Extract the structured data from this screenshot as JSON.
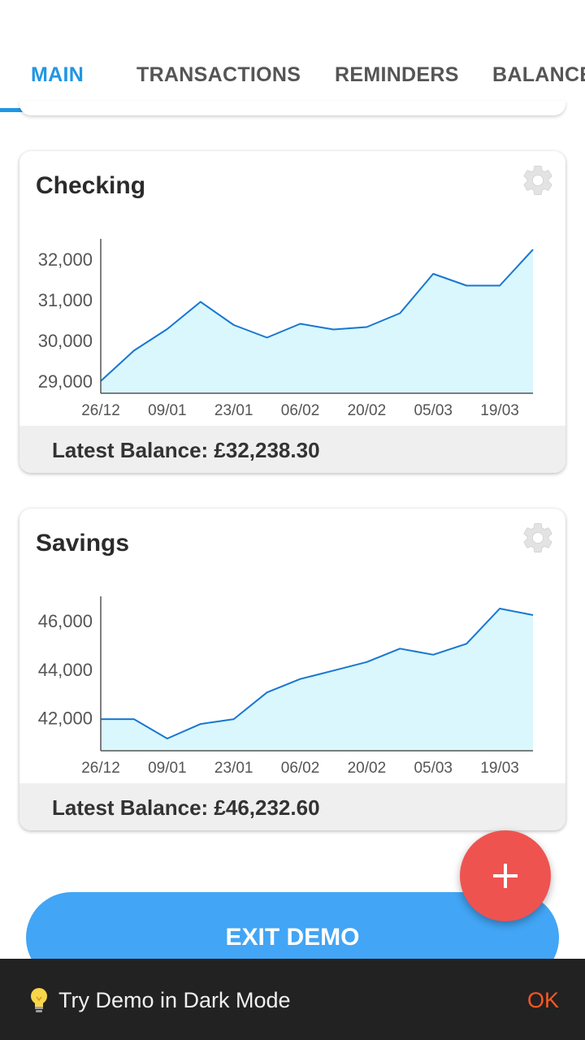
{
  "tabs": [
    {
      "label": "MAIN",
      "active": true
    },
    {
      "label": "TRANSACTIONS",
      "active": false
    },
    {
      "label": "REMINDERS",
      "active": false
    },
    {
      "label": "BALANCE",
      "active": false
    }
  ],
  "accounts": [
    {
      "name": "Checking",
      "latest_balance_label": "Latest Balance: £32,238.30"
    },
    {
      "name": "Savings",
      "latest_balance_label": "Latest Balance: £46,232.60"
    }
  ],
  "chart_data": [
    {
      "type": "area",
      "title": "Checking",
      "x_tick_labels": [
        "26/12",
        "09/01",
        "23/01",
        "06/02",
        "20/02",
        "05/03",
        "19/03"
      ],
      "y_tick_labels": [
        "29,000",
        "30,000",
        "31,000",
        "32,000"
      ],
      "y_ticks": [
        29000,
        30000,
        31000,
        32000
      ],
      "ylim": [
        28700,
        32500
      ],
      "x_index": [
        0,
        1,
        2,
        3,
        4,
        5,
        6,
        7,
        8,
        9,
        10,
        11,
        12,
        13
      ],
      "values": [
        29000,
        29750,
        30280,
        30950,
        30380,
        30070,
        30410,
        30270,
        30330,
        30670,
        31640,
        31350,
        31350,
        32238.3
      ],
      "line_color": "#1976d2",
      "fill_color": "#d9f7fd"
    },
    {
      "type": "area",
      "title": "Savings",
      "x_tick_labels": [
        "26/12",
        "09/01",
        "23/01",
        "06/02",
        "20/02",
        "05/03",
        "19/03"
      ],
      "y_tick_labels": [
        "42,000",
        "44,000",
        "46,000"
      ],
      "y_ticks": [
        42000,
        44000,
        46000
      ],
      "ylim": [
        40650,
        47000
      ],
      "x_index": [
        0,
        1,
        2,
        3,
        4,
        5,
        6,
        7,
        8,
        9,
        10,
        11,
        12,
        13
      ],
      "values": [
        41950,
        41950,
        41150,
        41750,
        41950,
        43050,
        43600,
        43950,
        44300,
        44850,
        44600,
        45050,
        46500,
        46232.6
      ],
      "line_color": "#1976d2",
      "fill_color": "#d9f7fd"
    }
  ],
  "exit_button": {
    "label": "EXIT DEMO"
  },
  "snackbar": {
    "message": "Try Demo in Dark Mode",
    "action": "OK",
    "icon": "lightbulb-icon"
  },
  "colors": {
    "accent": "#2196e3",
    "fab": "#ef5350",
    "button": "#42a5f5",
    "snack_action": "#ff5722"
  }
}
